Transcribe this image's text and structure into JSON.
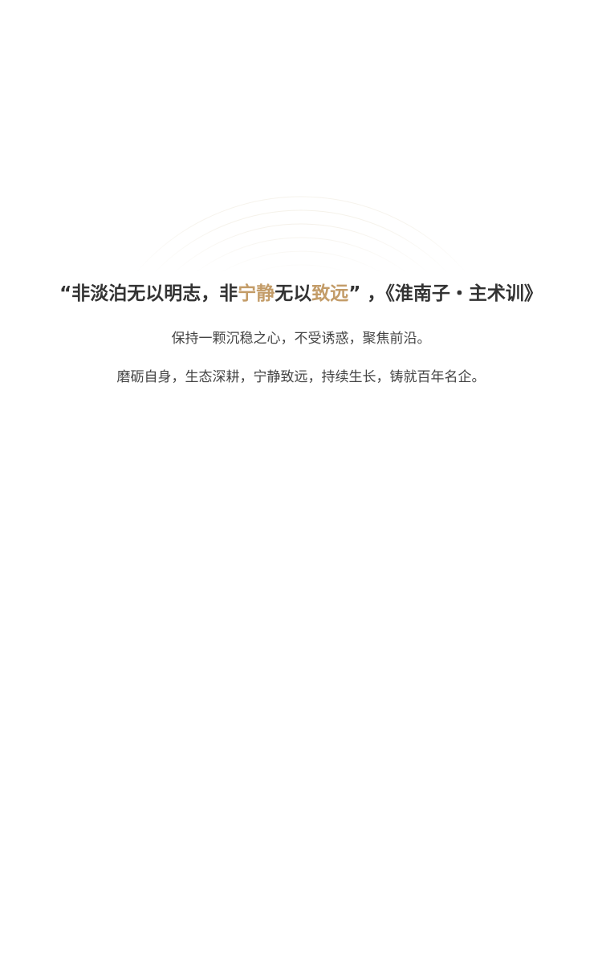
{
  "motto": {
    "open_quote": "“",
    "part1": "非淡泊无以明志，非",
    "highlight1": "宁静",
    "part2": "无以",
    "highlight2": "致远",
    "close_quote": "”",
    "separator": " ，",
    "source": "《淮南子・主术训》"
  },
  "lines": [
    "保持一颗沉稳之心，不受诱惑，聚焦前沿。",
    "磨砺自身，生态深耕，宁静致远，持续生长，铸就百年名企。"
  ],
  "colors": {
    "text": "#333333",
    "accent": "#c39c68",
    "arc": "#c9b88f"
  }
}
